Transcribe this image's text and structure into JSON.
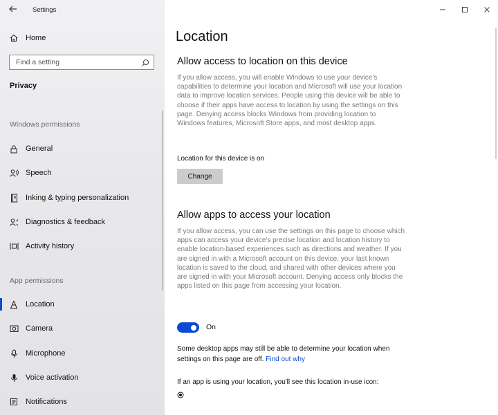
{
  "window": {
    "title": "Settings",
    "controls": [
      "minimize",
      "maximize",
      "close"
    ]
  },
  "sidebar": {
    "home_label": "Home",
    "search_placeholder": "Find a setting",
    "section_title": "Privacy",
    "groups": [
      {
        "title": "Windows permissions",
        "items": [
          {
            "label": "General",
            "icon": "lock-icon"
          },
          {
            "label": "Speech",
            "icon": "speech-icon"
          },
          {
            "label": "Inking & typing personalization",
            "icon": "notebook-icon"
          },
          {
            "label": "Diagnostics & feedback",
            "icon": "diagnostics-icon"
          },
          {
            "label": "Activity history",
            "icon": "activity-icon"
          }
        ]
      },
      {
        "title": "App permissions",
        "items": [
          {
            "label": "Location",
            "icon": "location-icon",
            "selected": true
          },
          {
            "label": "Camera",
            "icon": "camera-icon"
          },
          {
            "label": "Microphone",
            "icon": "microphone-icon"
          },
          {
            "label": "Voice activation",
            "icon": "voice-icon"
          },
          {
            "label": "Notifications",
            "icon": "notifications-icon"
          }
        ]
      }
    ]
  },
  "main": {
    "page_title": "Location",
    "device_section": {
      "heading": "Allow access to location on this device",
      "description": "If you allow access, you will enable Windows to use your device's capabilities to determine your location and Microsoft will use your location data to improve location services. People using this device will be able to choose if their apps have access to location by using the settings on this page. Denying access blocks Windows from providing location to Windows features, Microsoft Store apps, and most desktop apps.",
      "status": "Location for this device is on",
      "change_button": "Change"
    },
    "apps_section": {
      "heading": "Allow apps to access your location",
      "description": "If you allow access, you can use the settings on this page to choose which apps can access your device's precise location and location history to enable location-based experiences such as directions and weather. If you are signed in with a Microsoft account on this device, your last known location is saved to the cloud, and shared with other devices where you are signed in with your Microsoft account. Denying access only blocks the apps listed on this page from accessing your location.",
      "toggle_state": "On",
      "desktop_note": "Some desktop apps may still be able to determine your location when settings on this page are off.",
      "find_out_link": "Find out why",
      "inuse_note": "If an app is using your location, you'll see this location in-use icon:"
    }
  },
  "colors": {
    "accent": "#0a4bd1",
    "sidebar_bg": "#e8e8eb",
    "description_text": "#7a7a7a",
    "button_bg": "#cccccc"
  }
}
